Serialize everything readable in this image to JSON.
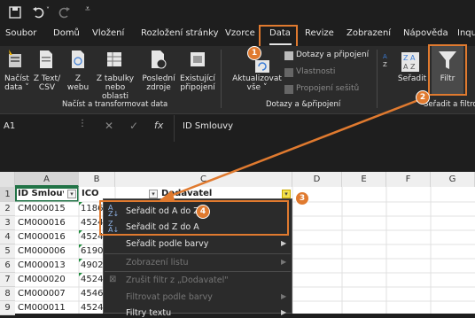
{
  "tabs": [
    "Soubor",
    "Domů",
    "Vložení",
    "Rozložení stránky",
    "Vzorce",
    "Data",
    "Revize",
    "Zobrazení",
    "Nápověda",
    "Inqu"
  ],
  "ribbon": {
    "nacist_data": "Načíst\ndata ˅",
    "z_text": "Z Text/\nCSV",
    "z_webu": "Z\nwebu",
    "z_tabulky": "Z tabulky\nnebo oblasti",
    "posledni_zdroje": "Poslední\nzdroje",
    "existujici": "Existující\npřipojení",
    "group1": "Načíst a transformovat data",
    "aktualizovat": "Aktualizovat\nvše ˅",
    "dotazy": "Dotazy a připojení",
    "vlastnosti": "Vlastnosti",
    "propojeni": "Propojení sešitů",
    "group2": "Dotazy a &připojení",
    "seradit": "Seřadit",
    "filtr": "Filtr",
    "group3": "Seřadit a filtro"
  },
  "formula": {
    "namebox": "A1",
    "fx": "fx",
    "content": "ID Smlouvy"
  },
  "columns": [
    "A",
    "B",
    "C",
    "D",
    "E",
    "F",
    "G"
  ],
  "rows": [
    "1",
    "2",
    "3",
    "4",
    "5",
    "6",
    "7",
    "8",
    "9",
    "10"
  ],
  "headers": {
    "a": "ID Smlouv",
    "b": "IČO",
    "c": "Dodavatel"
  },
  "ids": [
    "CM000015",
    "CM000016",
    "CM000016",
    "CM000006",
    "CM000013",
    "CM000020",
    "CM000007",
    "CM000011",
    "CM000011"
  ],
  "ico": [
    "1186",
    "4524",
    "4524",
    "6190",
    "4902",
    "4524",
    "4546",
    "4524",
    "4524"
  ],
  "menu": {
    "sort_az": "Seřadit od A do Z",
    "sort_za": "Seřadit od Z do A",
    "sort_color": "Seřadit podle barvy",
    "sheet_view": "Zobrazení listu",
    "clear_filter": "Zrušit filtr z „Dodavatel\"",
    "filter_color": "Filtrovat podle barvy",
    "text_filters": "Filtry textu"
  },
  "badges": [
    "1",
    "2",
    "3",
    "4"
  ],
  "colors": {
    "accent": "#e07a2f",
    "bg": "#1e1e1e",
    "ribbon": "#2b2b2b"
  }
}
